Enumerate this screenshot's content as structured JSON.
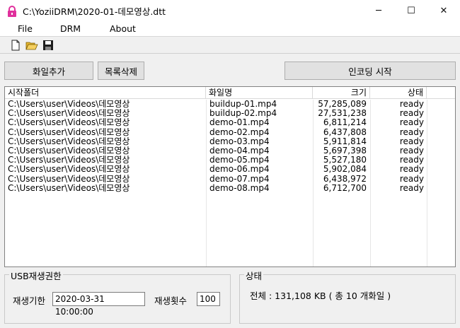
{
  "window": {
    "title": "C:\\YoziiDRM\\2020-01-데모영상.dtt",
    "icon": "lock-icon",
    "controls": {
      "minimize": "─",
      "maximize": "☐",
      "close": "✕"
    }
  },
  "menu": {
    "items": [
      {
        "label": "File"
      },
      {
        "label": "DRM"
      },
      {
        "label": "About"
      }
    ]
  },
  "toolbar": {
    "icons": [
      "new-file-icon",
      "open-folder-icon",
      "save-icon"
    ]
  },
  "buttons": {
    "add_files": "화일추가",
    "clear_list": "목록삭제",
    "start_encoding": "인코딩 시작"
  },
  "table": {
    "headers": {
      "folder": "시작폴더",
      "filename": "화일명",
      "size": "크기",
      "status": "상태"
    },
    "rows": [
      {
        "folder": "C:\\Users\\user\\Videos\\데모영상",
        "filename": "buildup-01.mp4",
        "size": "57,285,089",
        "status": "ready"
      },
      {
        "folder": "C:\\Users\\user\\Videos\\데모영상",
        "filename": "buildup-02.mp4",
        "size": "27,531,238",
        "status": "ready"
      },
      {
        "folder": "C:\\Users\\user\\Videos\\데모영상",
        "filename": "demo-01.mp4",
        "size": "6,811,214",
        "status": "ready"
      },
      {
        "folder": "C:\\Users\\user\\Videos\\데모영상",
        "filename": "demo-02.mp4",
        "size": "6,437,808",
        "status": "ready"
      },
      {
        "folder": "C:\\Users\\user\\Videos\\데모영상",
        "filename": "demo-03.mp4",
        "size": "5,911,814",
        "status": "ready"
      },
      {
        "folder": "C:\\Users\\user\\Videos\\데모영상",
        "filename": "demo-04.mp4",
        "size": "5,697,398",
        "status": "ready"
      },
      {
        "folder": "C:\\Users\\user\\Videos\\데모영상",
        "filename": "demo-05.mp4",
        "size": "5,527,180",
        "status": "ready"
      },
      {
        "folder": "C:\\Users\\user\\Videos\\데모영상",
        "filename": "demo-06.mp4",
        "size": "5,902,084",
        "status": "ready"
      },
      {
        "folder": "C:\\Users\\user\\Videos\\데모영상",
        "filename": "demo-07.mp4",
        "size": "6,438,972",
        "status": "ready"
      },
      {
        "folder": "C:\\Users\\user\\Videos\\데모영상",
        "filename": "demo-08.mp4",
        "size": "6,712,700",
        "status": "ready"
      }
    ]
  },
  "usb_rights": {
    "title": "USB재생권한",
    "expiry_label": "재생기한",
    "expiry_value": "2020-03-31 10:00:00",
    "count_label": "재생횟수",
    "count_value": "100"
  },
  "status": {
    "title": "상태",
    "summary": "전체 : 131,108 KB ( 총 10 개화일 )"
  },
  "colors": {
    "lock_icon": "#e0309c",
    "folder_icon": "#e8b830",
    "save_icon": "#1c1c1c"
  }
}
